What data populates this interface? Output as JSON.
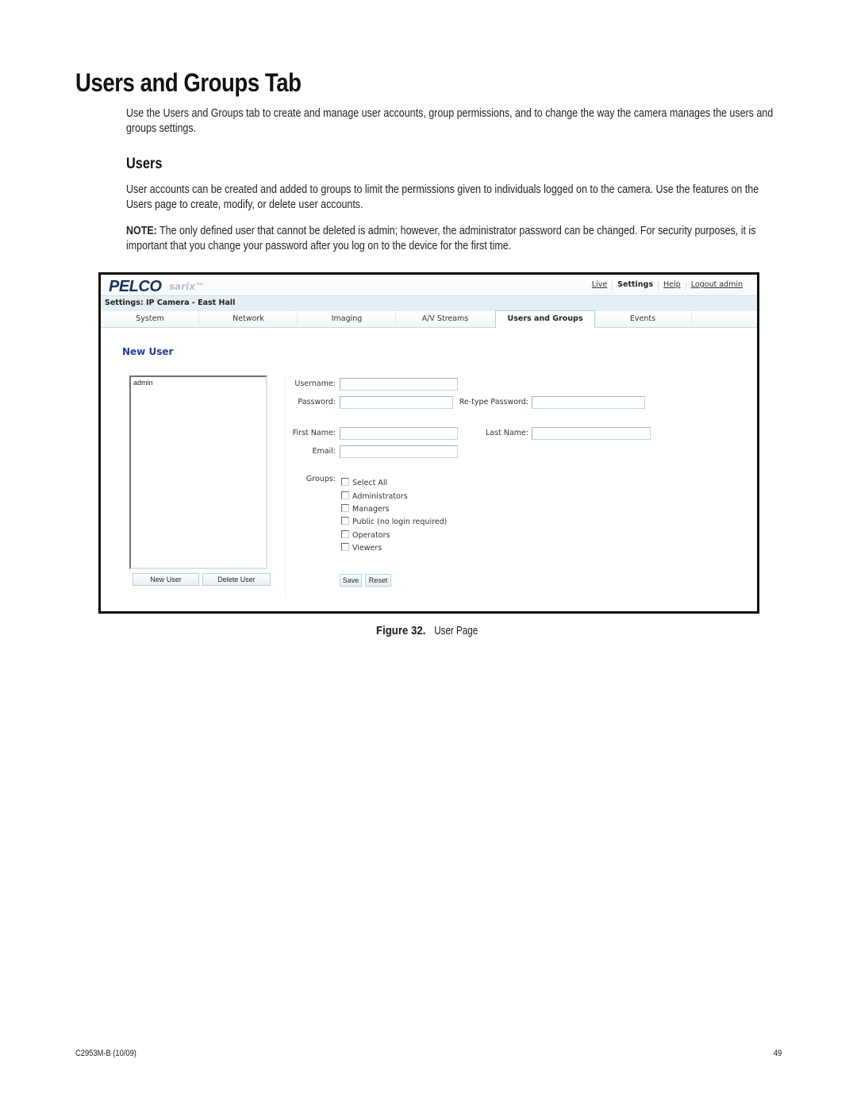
{
  "document": {
    "title": "Users and Groups Tab",
    "intro": "Use the Users and Groups tab to create and manage user accounts, group permissions, and to change the way the camera manages the users and groups settings.",
    "section_heading": "Users",
    "section_body": "User accounts can be created and added to groups to limit the permissions given to individuals logged on to the camera. Use the features on the Users page to create, modify, or delete user accounts.",
    "note_label": "NOTE:",
    "note_text": " The only defined user  that cannot be deleted is admin; however, the administrator password can be changed. For security purposes, it is important that you change your password after you log on to the device for the first time.",
    "figure_label": "Figure 32.",
    "figure_caption": "User Page",
    "footer_doc_id": "C2953M-B (10/09)",
    "footer_page": "49"
  },
  "app": {
    "logo": "PELCO",
    "logo_sub": "sarix™",
    "top_links": {
      "live": "Live",
      "settings": "Settings",
      "help": "Help",
      "logout": "Logout admin"
    },
    "breadcrumb": "Settings: IP Camera - East Hall",
    "tabs": [
      {
        "label": "System",
        "active": false
      },
      {
        "label": "Network",
        "active": false
      },
      {
        "label": "Imaging",
        "active": false
      },
      {
        "label": "A/V Streams",
        "active": false
      },
      {
        "label": "Users and Groups",
        "active": true
      },
      {
        "label": "Events",
        "active": false
      }
    ],
    "content_title": "New User",
    "user_list": [
      "admin"
    ],
    "buttons": {
      "new_user": "New User",
      "delete_user": "Delete User",
      "save": "Save",
      "reset": "Reset"
    },
    "fields": {
      "username_label": "Username:",
      "username_value": "",
      "password_label": "Password:",
      "password_value": "",
      "retype_password_label": "Re-type Password:",
      "retype_password_value": "",
      "first_name_label": "First Name:",
      "first_name_value": "",
      "last_name_label": "Last Name:",
      "last_name_value": "",
      "email_label": "Email:",
      "email_value": ""
    },
    "groups_label": "Groups:",
    "groups": [
      {
        "label": "Select All",
        "checked": false
      },
      {
        "label": "Administrators",
        "checked": false
      },
      {
        "label": "Managers",
        "checked": false
      },
      {
        "label": "Public (no login required)",
        "checked": false
      },
      {
        "label": "Operators",
        "checked": false
      },
      {
        "label": "Viewers",
        "checked": false
      }
    ]
  }
}
